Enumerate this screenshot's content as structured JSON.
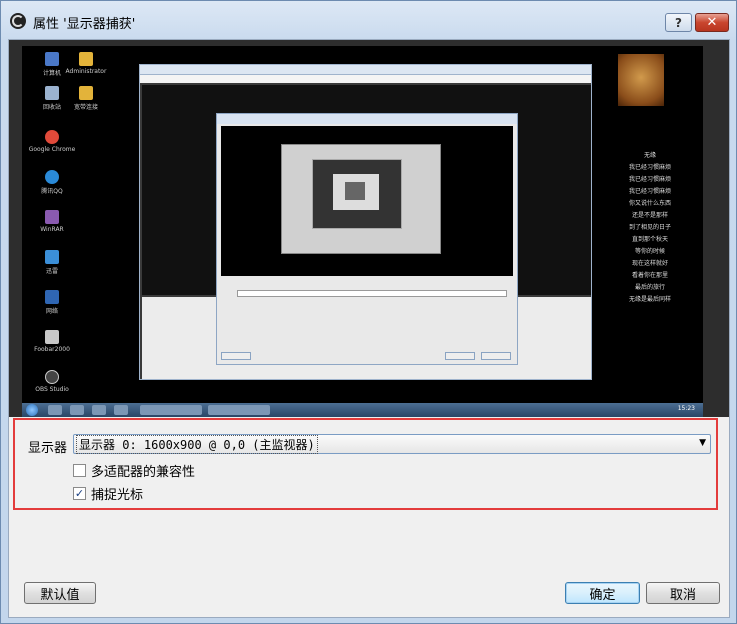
{
  "window": {
    "title": "属性 '显示器捕获'",
    "help_label": "?",
    "close_label": "✕"
  },
  "preview": {
    "desktop_icons": [
      "计算机",
      "Administrator",
      "回收站",
      "宽带连接",
      "Google Chrome",
      "腾讯QQ",
      "WinRAR",
      "迅雷",
      "网络",
      "Foobar2000",
      "OBS Studio"
    ],
    "poem_lines": [
      "无缘",
      "我已经习惯麻烦",
      "我已经习惯麻烦",
      "我已经习惯麻烦",
      "你又说什么东西",
      "还是不是那样",
      "到了相见的日子",
      "直到那个秋天",
      "等你的时候",
      "现在这样就好",
      "看着你在那里",
      "最后的旅行",
      "无缘是最后同样"
    ],
    "taskbar_clock": "15:23"
  },
  "settings": {
    "display_label": "显示器",
    "display_value": "显示器 0: 1600x900 @ 0,0 (主监视器)",
    "display_arrow": "▼",
    "multi_adapter_label": "多适配器的兼容性",
    "multi_adapter_checked": false,
    "capture_cursor_label": "捕捉光标",
    "capture_cursor_checked": true,
    "check_mark": "✓"
  },
  "buttons": {
    "defaults_label": "默认值",
    "ok_label": "确定",
    "cancel_label": "取消"
  },
  "colors": {
    "highlight_frame": "#e33c3c",
    "title_bar": "#c9daee"
  }
}
